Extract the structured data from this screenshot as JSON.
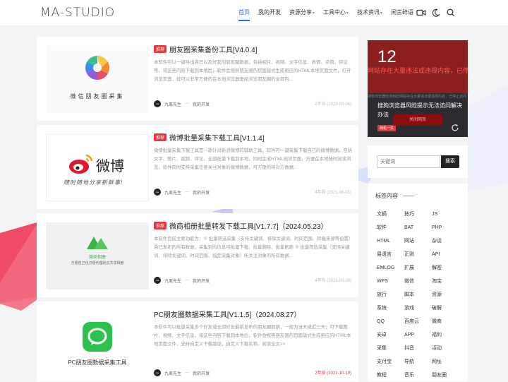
{
  "header": {
    "logo": "MA-STUDIO",
    "nav": [
      {
        "label": "首页",
        "active": true,
        "dropdown": false
      },
      {
        "label": "我的开发",
        "active": false,
        "dropdown": false
      },
      {
        "label": "资源分享",
        "active": false,
        "dropdown": true
      },
      {
        "label": "工具中心",
        "active": false,
        "dropdown": true
      },
      {
        "label": "技术资讯",
        "active": false,
        "dropdown": true
      },
      {
        "label": "闲言碎语",
        "active": false,
        "dropdown": false
      }
    ],
    "icons": [
      "video-icon",
      "moon-icon",
      "search-icon"
    ]
  },
  "posts": [
    {
      "tag": "推荐",
      "title": "朋友圈采集备份工具[V4.0.4]",
      "excerpt": "本软件可以一键导出自己以及好友的朋友圈数据，包括相片、视频、文字信息、表情、点赞、评论等，将这些内容下载到本地后，软件会按照朋友圈的页面版式生成相应的HTML本地页面文件，打开浏览页面，就可以非常方便的在本地浏览器查阅浏览朋友圈的全部内...",
      "author": "九离先生",
      "category": "我的开发",
      "date": "2年前 (2023-03-06)",
      "thumb_caption": "微信朋友圈采集"
    },
    {
      "tag": "推荐",
      "title": "微博批量采集下载工具[V1.1.4]",
      "excerpt": "微博批量采集下载工具是一款针对新浪微博的辅助工具，软件可一键采集下载自己的微博数据，包括文字、图片、视频、评论，全部批量下载到本地，同时生成HTML阅读页面，方便在本地随时阅读浏览。软件同时支持采集任意关注对象的微博数据，可方便的将对方数据...",
      "author": "九离先生",
      "category": "我的开发",
      "date": "4年前 (2021-06-01)",
      "thumb_title": "微博",
      "thumb_caption": "随时随地分享新鲜事!"
    },
    {
      "tag": "推荐",
      "title": "微商相册批量转发下载工具[V1.7.7]（2024.05.23）",
      "excerpt": "本软件目前主要功能为：① 批量筛选采集（支持关键词、排除关键词、时间范围、转载来源等设置）自己发布的所有数据，采集到的信息可批量下载、批量删除、批量刷新 ② 批量筛选采集（支持关键词、排除关键词、时间范围、指定采集对象）所关注对象的所有数据...",
      "author": "九离先生",
      "category": "我的开发",
      "date": "4年前 (2021-03-28)",
      "thumb_title": "微商相册",
      "thumb_caption": "方便自己也方便代理的云共享相册"
    },
    {
      "tag": "",
      "title": "PC朋友圈数据采集工具[V1.1.5]（2024.08.27）",
      "excerpt": "本软件可以批量采集多个好友或全部好友最新发布的朋友圈数据，一般为当天或近三天，可下载图片、视频、文字信息，将这些内容下载到本地后，软件会按照朋友圈的页面版式生成相应的HTML本地页面文件，支持自定义下载路径，自定义下载名称。阅读全文>>",
      "author": "九离先生",
      "category": "我的开发",
      "date": "2年前 (2022-10-19)",
      "thumb_caption": "PC朋友圈数据采集工具"
    }
  ],
  "slider": {
    "number": "12",
    "red_text": "网站存在大量违法或违规内容，已停",
    "small_text": "搜狗浏览器检测到此网站存在大量违法或违规内容，已停止访问",
    "title": "搜狗浏览器风险提示无法访问解决办法",
    "badge": "随机一文",
    "cta": "关闭网页"
  },
  "search": {
    "placeholder": "关键词",
    "button": "搜索"
  },
  "tags": {
    "title": "标签内容",
    "items": [
      "文摘",
      "技巧",
      "JS",
      "软件",
      "BAT",
      "PHP",
      "HTML",
      "网站",
      "杂谈",
      "易语言",
      "正则",
      "API",
      "EMLOG",
      "扩展",
      "解密",
      "WPS",
      "微信",
      "淘宝",
      "旅行",
      "脚本",
      "资源",
      "系统",
      "游戏",
      "破解",
      "QQ",
      "百度云",
      "微商",
      "安卓",
      "APP",
      "福利",
      "采集",
      "抖音",
      "活动",
      "支付宝",
      "导航",
      "网址",
      "教程",
      "音乐",
      "朋友圈"
    ]
  },
  "colors": {
    "accent": "#2c6cf5",
    "tag_red": "#e5383d"
  }
}
